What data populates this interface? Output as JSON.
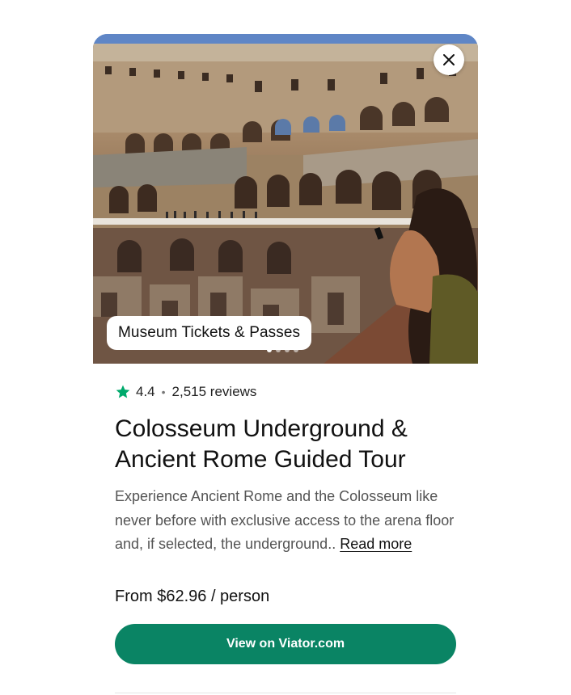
{
  "hero": {
    "category": "Museum Tickets & Passes",
    "carousel_total": 4,
    "carousel_active": 0
  },
  "close_icon": "close-icon",
  "rating": {
    "score": "4.4",
    "separator": "•",
    "reviews": "2,515 reviews",
    "star_color": "#00aa6c"
  },
  "tour": {
    "title": "Colosseum Underground & Ancient Rome Guided Tour",
    "description": "Experience Ancient Rome and the Colosseum like never before with exclusive access to the arena floor and, if selected, the underground..",
    "read_more": "Read more"
  },
  "price": {
    "label": "From $62.96 / person"
  },
  "cta": {
    "label": "View on Viator.com",
    "color": "#0a8464"
  }
}
